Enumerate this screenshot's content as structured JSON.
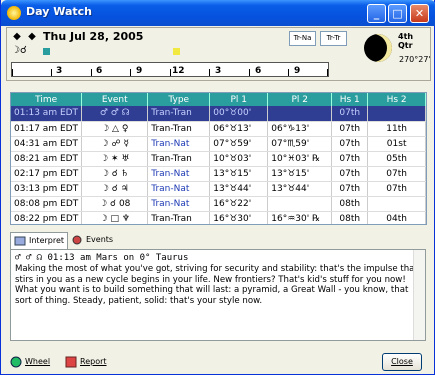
{
  "window": {
    "title": "Day Watch"
  },
  "header": {
    "date": "Thu Jul 28, 2005",
    "prev_arrow": "◆",
    "next_arrow": "◆",
    "aspect_glyphs": "☽☌",
    "mode_button_1": "Tr-Na",
    "mode_button_2": "Tr-Tr",
    "moon_phase": "4th Qtr",
    "moon_degree": "270°27'",
    "timeline_labels": [
      "3",
      "6",
      "9",
      "12",
      "3",
      "6",
      "9"
    ]
  },
  "table": {
    "columns": [
      "Time",
      "Event",
      "Type",
      "Pl 1",
      "Pl 2",
      "Hs 1",
      "Hs 2"
    ],
    "rows": [
      {
        "time": "01:13 am EDT",
        "event": "♂ ♂ ☊",
        "type": "Tran-Tran",
        "pl1": "00°♉00'",
        "pl2": "",
        "hs1": "07th",
        "hs2": "",
        "selected": true
      },
      {
        "time": "01:17 am EDT",
        "event": "☽ △ ♀",
        "type": "Tran-Tran",
        "pl1": "06°♉13'",
        "pl2": "06°♑13'",
        "hs1": "07th",
        "hs2": "11th"
      },
      {
        "time": "04:31 am EDT",
        "event": "☽ ☍ ☿",
        "type": "Tran-Nat",
        "pl1": "07°♉59'",
        "pl2": "07°♏59'",
        "hs1": "07th",
        "hs2": "01st"
      },
      {
        "time": "08:21 am EDT",
        "event": "☽ ✶ ♅",
        "type": "Tran-Tran",
        "pl1": "10°♉03'",
        "pl2": "10°♓03' ℞",
        "hs1": "07th",
        "hs2": "05th"
      },
      {
        "time": "02:17 pm EDT",
        "event": "☽ ☌ ♄",
        "type": "Tran-Nat",
        "pl1": "13°♉15'",
        "pl2": "13°♉15'",
        "hs1": "07th",
        "hs2": "07th"
      },
      {
        "time": "03:13 pm EDT",
        "event": "☽ ☌ ♃",
        "type": "Tran-Nat",
        "pl1": "13°♉44'",
        "pl2": "13°♉44'",
        "hs1": "07th",
        "hs2": "07th"
      },
      {
        "time": "08:08 pm EDT",
        "event": "☽ ☌ 08",
        "type": "Tran-Nat",
        "pl1": "16°♉22'",
        "pl2": "",
        "hs1": "08th",
        "hs2": ""
      },
      {
        "time": "08:22 pm EDT",
        "event": "☽ □ ♆",
        "type": "Tran-Tran",
        "pl1": "16°♉30'",
        "pl2": "16°♒30' ℞",
        "hs1": "08th",
        "hs2": "04th"
      }
    ]
  },
  "tabs": {
    "interpret": "Interpret",
    "events": "Events"
  },
  "interpretation": {
    "heading": "♂ ♂ ☊   01:13 am         Mars on 0° Taurus",
    "body": "Making the most of what you've got, striving for security and stability: that's the impulse that stirs in you as a new cycle begins in your life. New frontiers? That's kid's stuff for you now! What you want is to build something that will last: a pyramid, a Great Wall - you know, that sort of thing. Steady, patient, solid: that's your style now."
  },
  "footer": {
    "wheel": "Wheel",
    "report": "Report",
    "close": "Close"
  },
  "colors": {
    "table_header": "#2a9e9e",
    "selected_row": "#2f3e93",
    "title_bar": "#0653e0"
  }
}
